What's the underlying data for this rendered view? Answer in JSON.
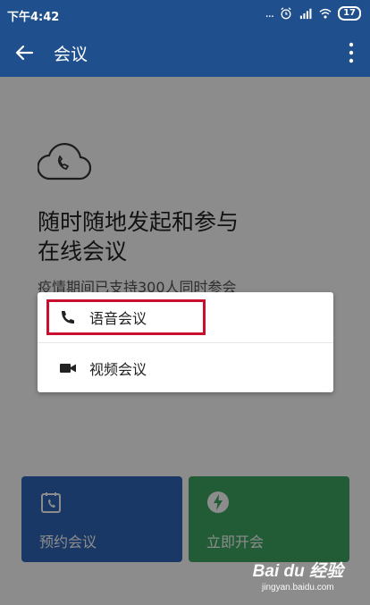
{
  "status_bar": {
    "time": "下午4:42",
    "dots": "...",
    "battery": "17",
    "icons": [
      "alarm-icon",
      "signal-icon",
      "wifi-icon",
      "battery-icon"
    ]
  },
  "app_bar": {
    "title": "会议",
    "back_icon": "arrow-left-icon",
    "menu_icon": "more-vert-icon"
  },
  "hero": {
    "icon": "cloud-phone-icon",
    "headline_line1": "随时随地发起和参与",
    "headline_line2": "在线会议",
    "subline": "疫情期间已支持300人同时参会"
  },
  "cards": {
    "schedule_label": "预约会议",
    "instant_label": "立即开会"
  },
  "dialog": {
    "voice_label": "语音会议",
    "video_label": "视频会议"
  },
  "watermark": {
    "logo": "Bai du 经验",
    "url": "jingyan.baidu.com"
  },
  "colors": {
    "app_bar": "#1f4f8c",
    "schedule_card": "#2f67b9",
    "instant_card": "#3da864",
    "highlight": "#c8102e"
  }
}
